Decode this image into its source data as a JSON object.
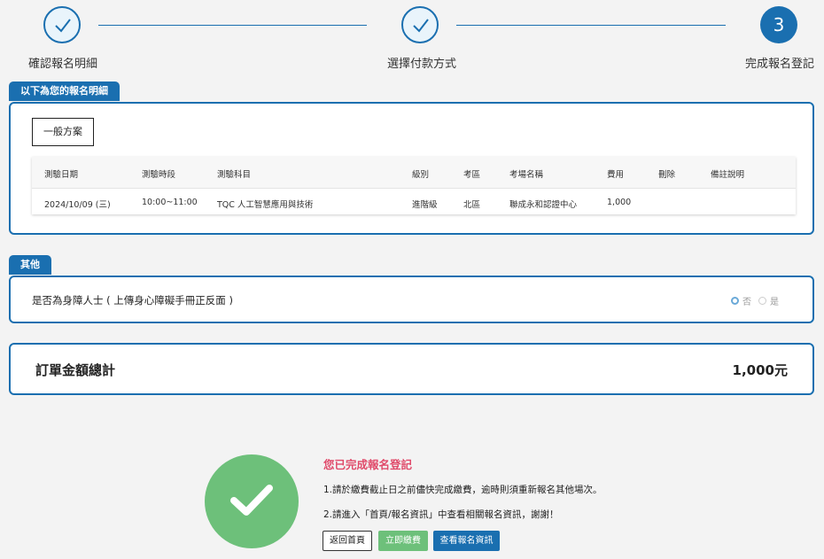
{
  "stepper": {
    "steps": [
      {
        "label": "確認報名明細",
        "status": "done"
      },
      {
        "label": "選擇付款方式",
        "status": "done"
      },
      {
        "label": "完成報名登記",
        "status": "active",
        "number": "3"
      }
    ]
  },
  "registration": {
    "tab_label": "以下為您的報名明細",
    "plan_name": "一般方案",
    "columns": [
      "測驗日期",
      "測驗時段",
      "測驗科目",
      "級別",
      "考區",
      "考場名稱",
      "費用",
      "刪除",
      "備註說明"
    ],
    "rows": [
      [
        "2024/10/09 (三)",
        "10:00~11:00",
        "TQC 人工智慧應用與技術",
        "進階級",
        "北區",
        "聯成永和認證中心",
        "1,000",
        "",
        ""
      ]
    ]
  },
  "other": {
    "tab_label": "其他",
    "question": "是否為身障人士 ( 上傳身心障礙手冊正反面 )",
    "options": [
      {
        "label": "否",
        "selected": true
      },
      {
        "label": "是",
        "selected": false
      }
    ]
  },
  "total": {
    "label": "訂單金額總計",
    "value": "1,000元"
  },
  "completion": {
    "title": "您已完成報名登記",
    "note1": "1.請於繳費截止日之前儘快完成繳費，逾時則須重新報名其他場次。",
    "note2": "2.請進入「首頁/報名資訊」中查看相關報名資訊，謝謝！",
    "buttons": {
      "home": "返回首頁",
      "pay": "立即繳費",
      "view": "查看報名資訊"
    }
  },
  "colors": {
    "primary": "#1a6fb0",
    "success": "#6dc07a",
    "alert": "#e04a6a"
  }
}
